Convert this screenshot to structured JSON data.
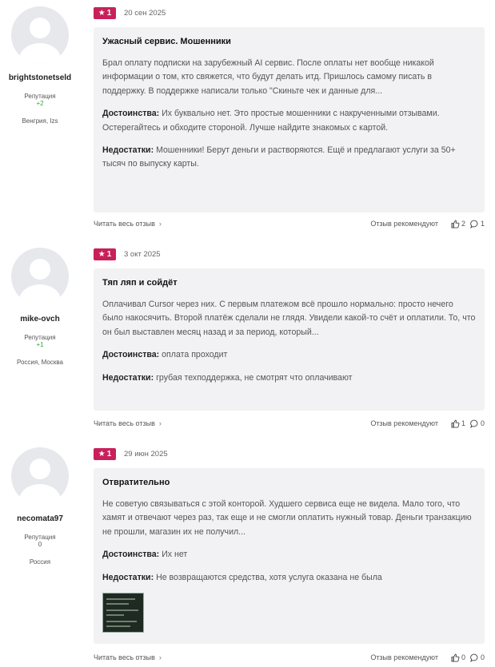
{
  "labels": {
    "reputation": "Репутация",
    "pros": "Достоинства:",
    "cons": "Недостатки:",
    "read_all": "Читать весь отзыв",
    "recommends": "Отзыв рекомендуют"
  },
  "reviews": [
    {
      "username": "brightstonetseld",
      "reputation": "+2",
      "location": "Венгрия, Izs",
      "rating": "1",
      "date": "20 сен 2025",
      "title": "Ужасный сервис. Мошенники",
      "text": "Брал оплату подписки на зарубежный AI сервис. После оплаты нет вообще никакой информации о том, кто свяжется, что будут делать итд. Пришлось самому писать в поддержку. В поддержке написали только \"Скиньте чек и данные для...",
      "pros": "Их буквально нет. Это простые мошенники с накрученными отзывами. Остерегайтесь и обходите стороной. Лучше найдите знакомых с картой.",
      "cons": "Мошенники! Берут деньги и растворяются. Ещё и предлагают услуги за 50+ тысяч по выпуску карты.",
      "likes": "2",
      "comments": "1"
    },
    {
      "username": "mike-ovch",
      "reputation": "+1",
      "location": "Россия, Москва",
      "rating": "1",
      "date": "3 окт 2025",
      "title": "Тяп ляп и сойдёт",
      "text": "Оплачивал Cursor через них. С первым платежом всё прошло нормально: просто нечего было накосячить. Второй платёж сделали не глядя. Увидели какой-то счёт и оплатили. То, что он был выставлен месяц назад и за период, который...",
      "pros": "оплата проходит",
      "cons": "грубая техподдержка, не смотрят что оплачивают",
      "likes": "1",
      "comments": "0"
    },
    {
      "username": "necomata97",
      "reputation": "0",
      "location": "Россия",
      "rating": "1",
      "date": "29 июн 2025",
      "title": "Отвратительно",
      "text": "Не советую связываться с этой конторой. Худшего сервиса еще не видела. Мало того, что хамят и отвечают через раз, так еще и не смогли оплатить нужный товар. Деньги транзакцию не прошли, магазин их не получил...",
      "pros": "Их нет",
      "cons": "Не возвращаются средства, хотя услуга оказана не была",
      "likes": "0",
      "comments": "0"
    }
  ],
  "colors": {
    "badge": "#c8205a",
    "card_bg": "#f2f2f4",
    "reputation_positive": "#3aa23a"
  },
  "icons": [
    "star-icon",
    "chevron-right-icon",
    "thumbs-up-icon",
    "comment-icon",
    "avatar-placeholder-icon"
  ]
}
